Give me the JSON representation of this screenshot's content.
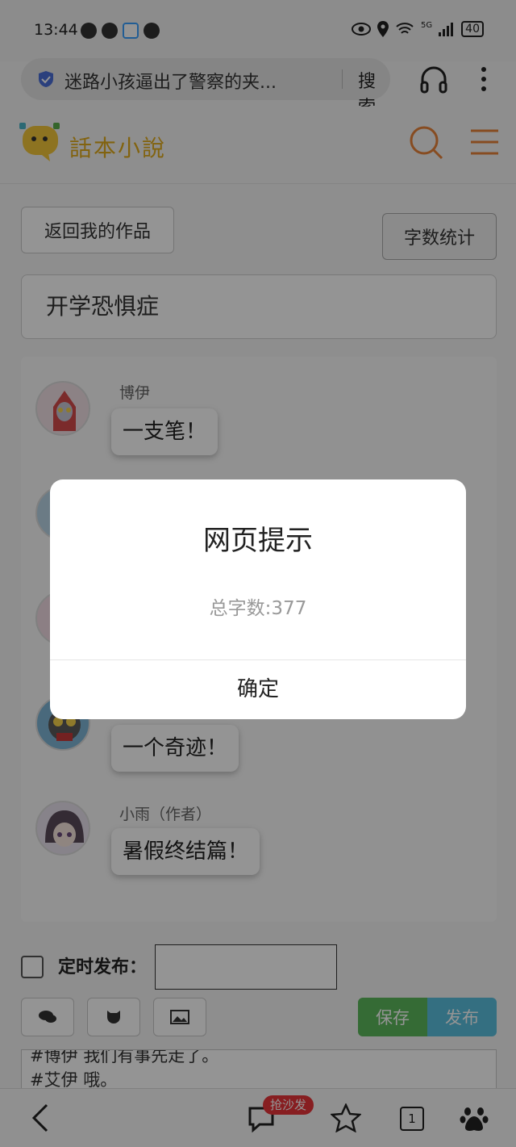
{
  "status_bar": {
    "time": "13:44",
    "battery": "40",
    "network": "5G"
  },
  "browser": {
    "url_text": "迷路小孩逼出了警察的夹...",
    "search_label": "搜索"
  },
  "site": {
    "logo_text": "話本小說"
  },
  "editor": {
    "back_button": "返回我的作品",
    "word_count_button": "字数统计",
    "story_title": "开学恐惧症"
  },
  "chat": {
    "messages": [
      {
        "speaker": "博伊",
        "text": "一支笔！"
      },
      {
        "speaker": "",
        "text": "一个奇迹！"
      },
      {
        "speaker": "小雨（作者）",
        "text": "暑假终结篇！"
      }
    ]
  },
  "schedule": {
    "label": "定时发布：",
    "value": ""
  },
  "actions": {
    "save": "保存",
    "publish": "发布"
  },
  "script_text": {
    "line1": "#博伊 我们有事先走了。",
    "line2": "#艾伊 哦。"
  },
  "bottom_nav": {
    "sofa_badge": "抢沙发",
    "tab_count": "1"
  },
  "dialog": {
    "title": "网页提示",
    "message": "总字数:377",
    "ok": "确定"
  },
  "colors": {
    "accent_logo": "#e1ab1a",
    "search_orange": "#e8843a",
    "save_green": "#5cb85c",
    "publish_blue": "#5bc0de",
    "badge_red": "#e8353a"
  }
}
